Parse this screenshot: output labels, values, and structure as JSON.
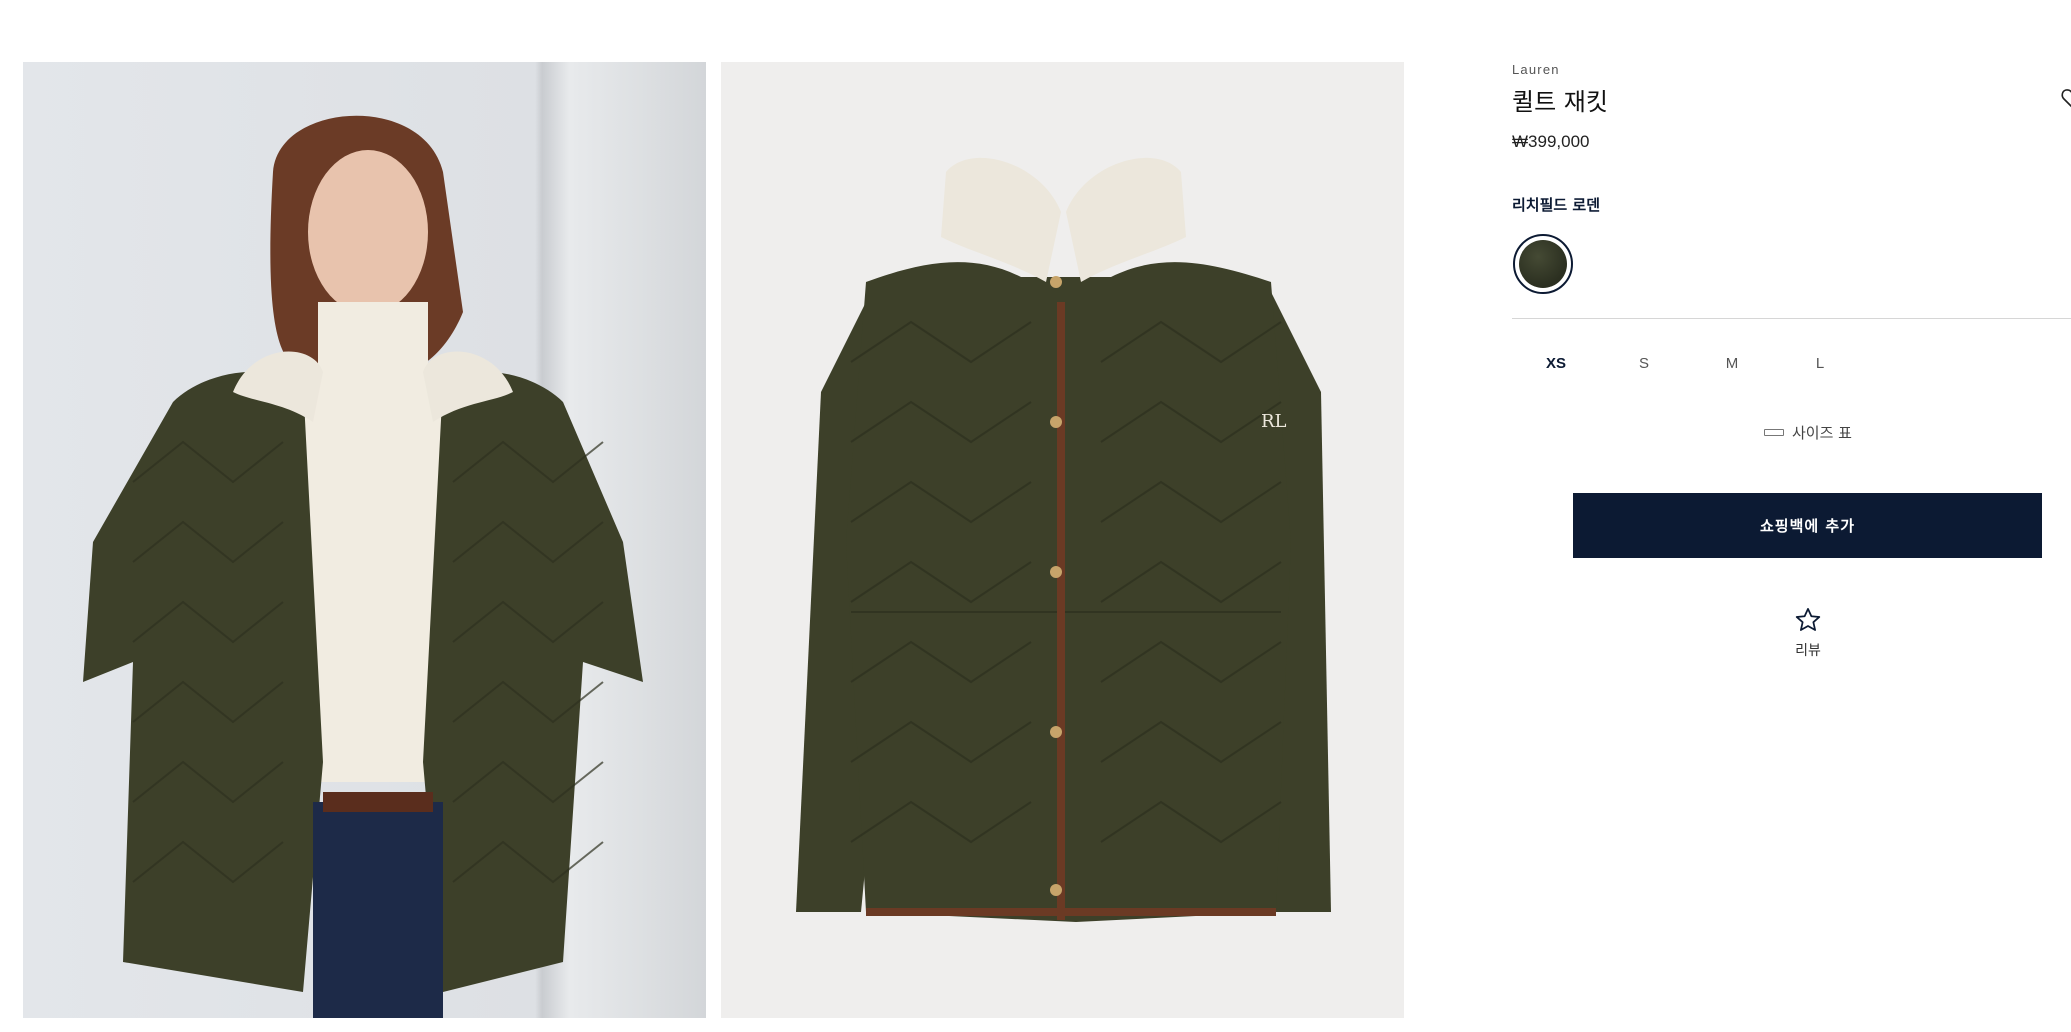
{
  "product": {
    "brand": "Lauren",
    "title": "퀼트 재킷",
    "price": "₩399,000",
    "color_name": "리치필드 로덴",
    "swatch_color": "#33371f",
    "sizes": [
      {
        "label": "XS",
        "selected": true
      },
      {
        "label": "S",
        "selected": false
      },
      {
        "label": "M",
        "selected": false
      },
      {
        "label": "L",
        "selected": false
      }
    ],
    "size_chart_label": "사이즈 표",
    "add_to_bag_label": "쇼핑백에 추가",
    "reviews_label": "리뷰"
  },
  "colors": {
    "primary": "#0c1a33",
    "jacket": "#3d4029",
    "trim": "#6b3a24",
    "collar": "#ece7dc"
  },
  "icons": {
    "wishlist": "heart-icon",
    "review": "star-icon",
    "size_chart": "ruler-icon"
  }
}
